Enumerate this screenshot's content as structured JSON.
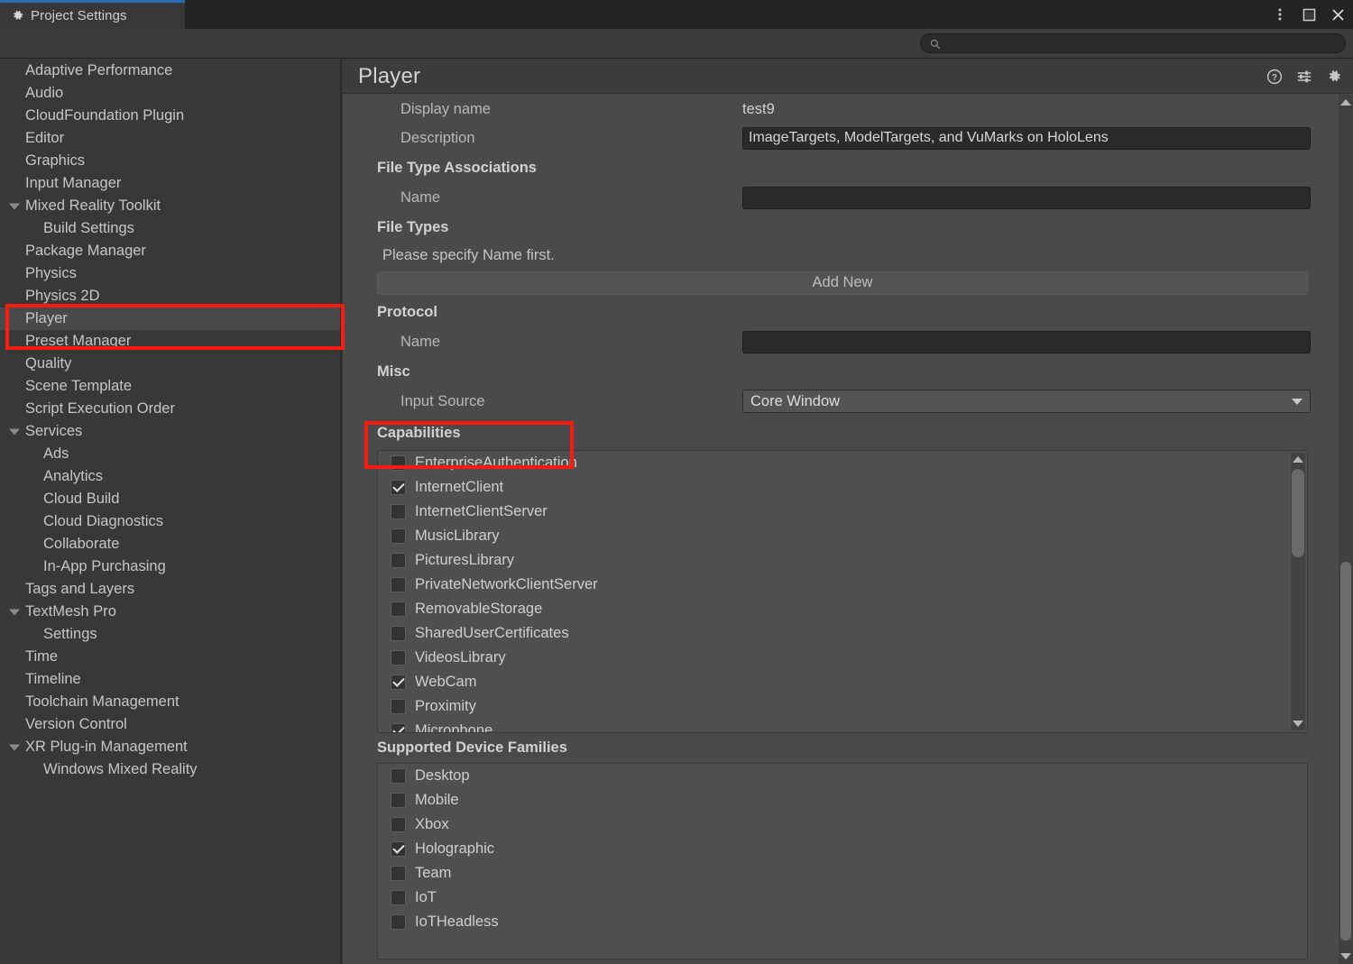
{
  "window": {
    "tab_label": "Project Settings",
    "tab_icon": "gear-icon",
    "controls": [
      {
        "name": "more-options-icon",
        "glyph": "vertical-dots"
      },
      {
        "name": "maximize-icon",
        "glyph": "square"
      },
      {
        "name": "close-icon",
        "glyph": "x"
      }
    ]
  },
  "toolbar": {
    "search_value": "",
    "search_placeholder": "",
    "search_icon": "search-icon"
  },
  "sidebar": {
    "items": [
      {
        "label": "Adaptive Performance",
        "level": 0,
        "expandable": false,
        "selected": false
      },
      {
        "label": "Audio",
        "level": 0,
        "expandable": false,
        "selected": false
      },
      {
        "label": "CloudFoundation Plugin",
        "level": 0,
        "expandable": false,
        "selected": false
      },
      {
        "label": "Editor",
        "level": 0,
        "expandable": false,
        "selected": false
      },
      {
        "label": "Graphics",
        "level": 0,
        "expandable": false,
        "selected": false
      },
      {
        "label": "Input Manager",
        "level": 0,
        "expandable": false,
        "selected": false
      },
      {
        "label": "Mixed Reality Toolkit",
        "level": 0,
        "expandable": true,
        "selected": false
      },
      {
        "label": "Build Settings",
        "level": 1,
        "expandable": false,
        "selected": false
      },
      {
        "label": "Package Manager",
        "level": 0,
        "expandable": false,
        "selected": false
      },
      {
        "label": "Physics",
        "level": 0,
        "expandable": false,
        "selected": false
      },
      {
        "label": "Physics 2D",
        "level": 0,
        "expandable": false,
        "selected": false
      },
      {
        "label": "Player",
        "level": 0,
        "expandable": false,
        "selected": true
      },
      {
        "label": "Preset Manager",
        "level": 0,
        "expandable": false,
        "selected": false
      },
      {
        "label": "Quality",
        "level": 0,
        "expandable": false,
        "selected": false
      },
      {
        "label": "Scene Template",
        "level": 0,
        "expandable": false,
        "selected": false
      },
      {
        "label": "Script Execution Order",
        "level": 0,
        "expandable": false,
        "selected": false
      },
      {
        "label": "Services",
        "level": 0,
        "expandable": true,
        "selected": false
      },
      {
        "label": "Ads",
        "level": 1,
        "expandable": false,
        "selected": false
      },
      {
        "label": "Analytics",
        "level": 1,
        "expandable": false,
        "selected": false
      },
      {
        "label": "Cloud Build",
        "level": 1,
        "expandable": false,
        "selected": false
      },
      {
        "label": "Cloud Diagnostics",
        "level": 1,
        "expandable": false,
        "selected": false
      },
      {
        "label": "Collaborate",
        "level": 1,
        "expandable": false,
        "selected": false
      },
      {
        "label": "In-App Purchasing",
        "level": 1,
        "expandable": false,
        "selected": false
      },
      {
        "label": "Tags and Layers",
        "level": 0,
        "expandable": false,
        "selected": false
      },
      {
        "label": "TextMesh Pro",
        "level": 0,
        "expandable": true,
        "selected": false
      },
      {
        "label": "Settings",
        "level": 1,
        "expandable": false,
        "selected": false
      },
      {
        "label": "Time",
        "level": 0,
        "expandable": false,
        "selected": false
      },
      {
        "label": "Timeline",
        "level": 0,
        "expandable": false,
        "selected": false
      },
      {
        "label": "Toolchain Management",
        "level": 0,
        "expandable": false,
        "selected": false
      },
      {
        "label": "Version Control",
        "level": 0,
        "expandable": false,
        "selected": false
      },
      {
        "label": "XR Plug-in Management",
        "level": 0,
        "expandable": true,
        "selected": false
      },
      {
        "label": "Windows Mixed Reality",
        "level": 1,
        "expandable": false,
        "selected": false
      }
    ]
  },
  "panel": {
    "title": "Player",
    "header_icons": [
      {
        "name": "help-icon",
        "glyph": "question-circle"
      },
      {
        "name": "preset-icon",
        "glyph": "sliders"
      },
      {
        "name": "settings-gear-icon",
        "glyph": "gear"
      }
    ],
    "display_name_label": "Display name",
    "display_name_value": "test9",
    "description_label": "Description",
    "description_value": "ImageTargets, ModelTargets, and VuMarks on HoloLens",
    "file_type_associations_header": "File Type Associations",
    "fta_name_label": "Name",
    "fta_name_value": "",
    "file_types_header": "File Types",
    "file_types_hint": "Please specify Name first.",
    "add_new_label": "Add New",
    "protocol_header": "Protocol",
    "protocol_name_label": "Name",
    "protocol_name_value": "",
    "misc_header": "Misc",
    "input_source_label": "Input Source",
    "input_source_value": "Core Window",
    "capabilities_header": "Capabilities",
    "capabilities": [
      {
        "label": "EnterpriseAuthentication",
        "checked": false
      },
      {
        "label": "InternetClient",
        "checked": true
      },
      {
        "label": "InternetClientServer",
        "checked": false
      },
      {
        "label": "MusicLibrary",
        "checked": false
      },
      {
        "label": "PicturesLibrary",
        "checked": false
      },
      {
        "label": "PrivateNetworkClientServer",
        "checked": false
      },
      {
        "label": "RemovableStorage",
        "checked": false
      },
      {
        "label": "SharedUserCertificates",
        "checked": false
      },
      {
        "label": "VideosLibrary",
        "checked": false
      },
      {
        "label": "WebCam",
        "checked": true
      },
      {
        "label": "Proximity",
        "checked": false
      },
      {
        "label": "Microphone",
        "checked": true
      }
    ],
    "device_families_header": "Supported Device Families",
    "device_families": [
      {
        "label": "Desktop",
        "checked": false
      },
      {
        "label": "Mobile",
        "checked": false
      },
      {
        "label": "Xbox",
        "checked": false
      },
      {
        "label": "Holographic",
        "checked": true
      },
      {
        "label": "Team",
        "checked": false
      },
      {
        "label": "IoT",
        "checked": false
      },
      {
        "label": "IoTHeadless",
        "checked": false
      }
    ]
  },
  "annotations": {
    "color": "#fb1b10",
    "boxes": [
      {
        "name": "player-nav-highlight"
      },
      {
        "name": "capabilities-highlight"
      }
    ]
  }
}
